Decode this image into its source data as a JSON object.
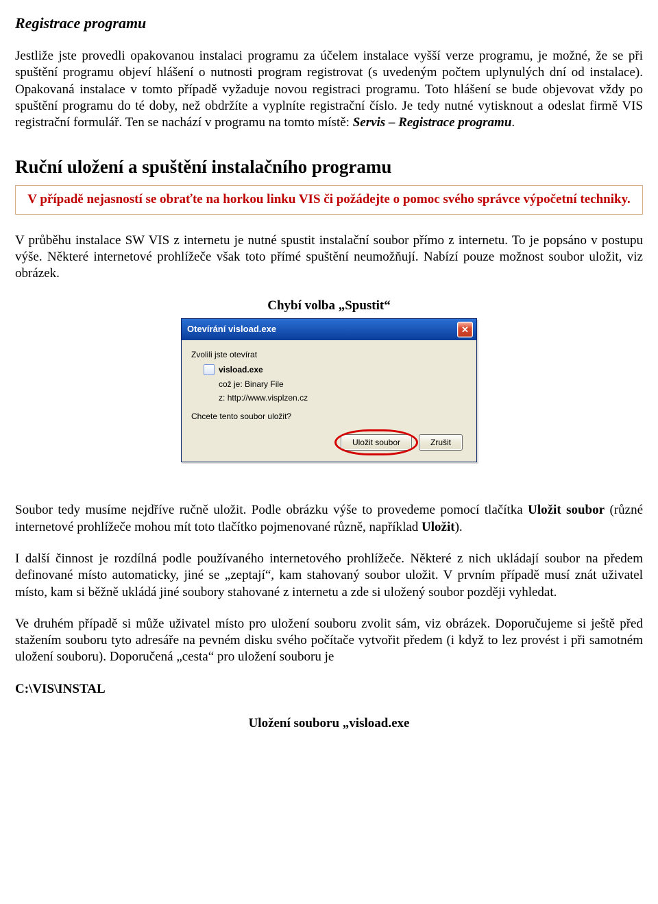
{
  "section1": {
    "title": "Registrace programu",
    "para_before": "Jestliže jste provedli opakovanou instalaci programu za účelem instalace vyšší verze programu, je možné, že se při spuštění programu objeví hlášení o nutnosti program registrovat (s uvedeným počtem uplynulých dní od instalace). Opakovaná instalace v tomto případě vyžaduje novou registraci programu. Toto hlášení se bude objevovat vždy po spuštění programu do té doby, než obdržíte a vyplníte registrační číslo. Je tedy nutné vytisknout a odeslat firmě VIS registrační formulář. Ten se nachází v programu na tomto místě: ",
    "para_em": "Servis – Registrace programu",
    "para_after": "."
  },
  "section2": {
    "title": "Ruční uložení a spuštění instalačního programu",
    "notice": "V případě nejasností se obraťte na horkou linku VIS či požádejte o pomoc svého správce výpočetní techniky.",
    "para1": "V průběhu instalace SW VIS z internetu je nutné spustit instalační soubor přímo z internetu. To je popsáno v postupu výše. Některé internetové prohlížeče však toto přímé spuštění neumožňují. Nabízí pouze možnost soubor uložit, viz obrázek.",
    "caption1": "Chybí volba „Spustit“"
  },
  "dialog": {
    "title": "Otevírání visload.exe",
    "line1": "Zvolili jste otevírat",
    "filename": "visload.exe",
    "type_label": "což je:",
    "type_value": "Binary File",
    "from_label": "z:",
    "from_value": "http://www.visplzen.cz",
    "question": "Chcete tento soubor uložit?",
    "btn_save": "Uložit soubor",
    "btn_cancel": "Zrušit"
  },
  "section3": {
    "p1_a": "Soubor tedy musíme nejdříve ručně uložit. Podle obrázku výše to provedeme pomocí tlačítka ",
    "p1_b1": "Uložit soubor",
    "p1_c": " (různé internetové prohlížeče mohou mít toto tlačítko pojmenované různě, například ",
    "p1_b2": "Uložit",
    "p1_d": ").",
    "p2": "I další činnost je rozdílná podle používaného internetového prohlížeče. Některé z nich ukládají soubor na předem definované místo automaticky, jiné se „zeptají“, kam stahovaný soubor uložit. V prvním případě musí znát uživatel místo, kam si běžně ukládá jiné soubory stahované z internetu a zde si uložený soubor později vyhledat.",
    "p3": "Ve druhém případě si může uživatel místo pro uložení souboru zvolit sám, viz obrázek. Doporučujeme si ještě před stažením souboru tyto adresáře na pevném disku svého počítače vytvořit předem (i když to lez provést i při samotném uložení souboru). Doporučená „cesta“ pro uložení souboru je",
    "path": "C:\\VIS\\INSTAL",
    "caption2": "Uložení souboru „visload.exe"
  }
}
